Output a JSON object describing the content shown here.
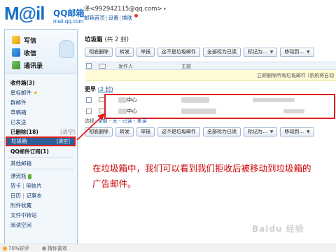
{
  "header": {
    "logo_main": "M@il",
    "logo_cn": "QQ邮箱",
    "logo_domain": "mail.qq.com",
    "user": "泽<992942115@qq.com>",
    "user_dropdown": "▾",
    "links": [
      "邮箱首页",
      "设置",
      "换肤"
    ],
    "link_sep": "|"
  },
  "sidebar": {
    "actions": {
      "write": "写信",
      "receive": "收信",
      "contacts": "通讯录"
    },
    "folders": {
      "inbox": "收件箱(3)",
      "starred": "星标邮件",
      "star": "★",
      "groups": "群邮件",
      "drafts": "草稿箱",
      "sent": "已发送",
      "deleted": "已删除(18)",
      "deleted_clear": "[清空]",
      "trash": "垃圾箱",
      "trash_clear": "[清空]",
      "qq_subs": "QQ邮件订阅(1)",
      "other": "其他邮箱",
      "drift_bottle": "漂流瓶",
      "cards": "贺卡",
      "postcards": "明信片",
      "calendar": "日历",
      "notes": "记事本",
      "attachments": "附件收藏",
      "transfer": "文件中转站",
      "reading": "阅读空间",
      "sep": "|"
    }
  },
  "main": {
    "title": "垃圾箱",
    "title_count": "(共 2 封)",
    "toolbar": {
      "thorough_delete": "彻底删除",
      "forward": "转发",
      "report": "举报",
      "not_spam": "这不是垃圾邮件",
      "mark_all_read": "全部标为已读",
      "mark_as": "标记为...",
      "move_to": "移动到..."
    },
    "columns": {
      "sender": "发件人",
      "subject": "主题"
    },
    "notice": "立即删除所有垃圾邮件 (系统将自动",
    "group_label": "更早",
    "group_count": "(2 封)",
    "rows": [
      {
        "sender": "中心"
      },
      {
        "sender": "中心"
      }
    ],
    "select_line": {
      "prefix": "选择:",
      "all": "全部",
      "sep": "-",
      "none": "无",
      "read": "已读",
      "unread": "未读"
    }
  },
  "annotation": "在垃圾箱中，我们可以看到我们拒收后被移动到垃圾箱的广告邮件。",
  "statusbar": {
    "rating": "70%好评",
    "comment": "猜你喜欢"
  },
  "watermark": "Baidu 经验",
  "colors": {
    "accent": "#1a6fc9",
    "highlight_border": "#e21d1d",
    "annotation_text": "#cc0000",
    "selected_folder_bg": "#2d5f99"
  }
}
